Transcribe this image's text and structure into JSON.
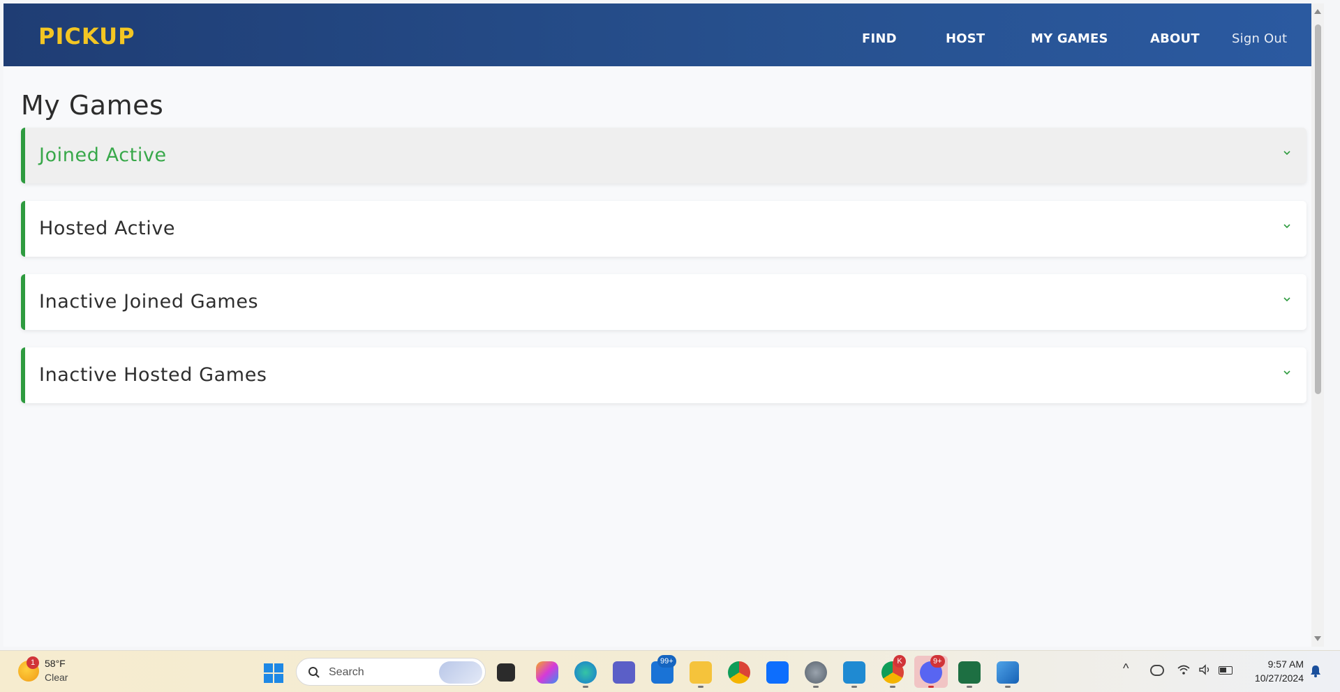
{
  "header": {
    "brand": "PICKUP",
    "nav": [
      "FIND",
      "HOST",
      "MY GAMES",
      "ABOUT"
    ],
    "sign_out": "Sign Out",
    "brand_color": "#f3c623",
    "bar_color": "#234a86"
  },
  "main": {
    "title": "My Games",
    "sections": [
      {
        "label": "Joined Active",
        "expanded_highlight": true
      },
      {
        "label": "Hosted Active",
        "expanded_highlight": false
      },
      {
        "label": "Inactive Joined Games",
        "expanded_highlight": false
      },
      {
        "label": "Inactive Hosted Games",
        "expanded_highlight": false
      }
    ],
    "accent_color": "#2e9b3f"
  },
  "taskbar": {
    "weather": {
      "badge": "1",
      "temp": "58°F",
      "desc": "Clear"
    },
    "search": {
      "placeholder": "Search"
    },
    "apps": [
      {
        "name": "task-view-icon"
      },
      {
        "name": "copilot-icon"
      },
      {
        "name": "edge-icon"
      },
      {
        "name": "teams-icon"
      },
      {
        "name": "mail-icon",
        "badge": "99+"
      },
      {
        "name": "file-explorer-icon"
      },
      {
        "name": "chrome-icon"
      },
      {
        "name": "cortana-icon"
      },
      {
        "name": "settings-icon"
      },
      {
        "name": "vscode-icon"
      },
      {
        "name": "chrome-profile-icon",
        "badge": "K"
      },
      {
        "name": "discord-icon",
        "badge": "9+"
      },
      {
        "name": "excel-icon"
      },
      {
        "name": "photos-icon"
      }
    ],
    "clock": {
      "time": "9:57 AM",
      "date": "10/27/2024"
    }
  }
}
